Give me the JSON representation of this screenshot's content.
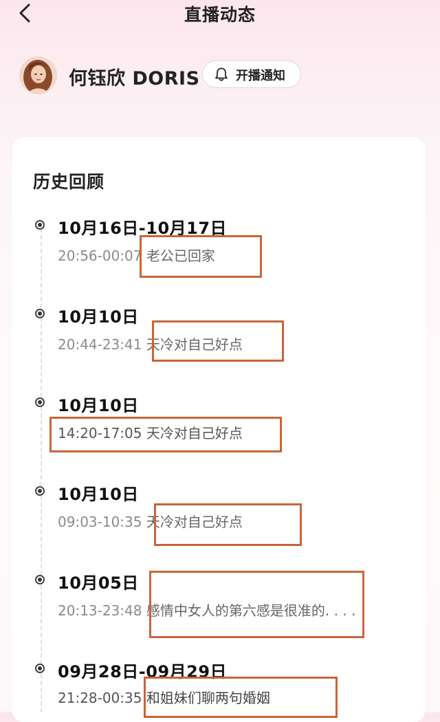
{
  "header": {
    "title": "直播动态"
  },
  "profile": {
    "name": "何钰欣 DORIS",
    "notify_label": "开播通知"
  },
  "history": {
    "title": "历史回顾",
    "entries": [
      {
        "date": "10月16日-10月17日",
        "time": "20:56-00:07",
        "desc": "老公已回家"
      },
      {
        "date": "10月10日",
        "time": "20:44-23:41",
        "desc": "天冷对自己好点"
      },
      {
        "date": "10月10日",
        "time": "14:20-17:05",
        "desc": "天冷对自己好点"
      },
      {
        "date": "10月10日",
        "time": "09:03-10:35",
        "desc": "天冷对自己好点"
      },
      {
        "date": "10月05日",
        "time": "20:13-23:48",
        "desc": "感情中女人的第六感是很准的. . . ."
      },
      {
        "date": "09月28日-09月29日",
        "time": "21:28-00:35",
        "desc": "和姐妹们聊两句婚姻"
      }
    ]
  },
  "colors": {
    "highlight_box": "#c8643a",
    "bg_top": "#fbe6ec"
  }
}
